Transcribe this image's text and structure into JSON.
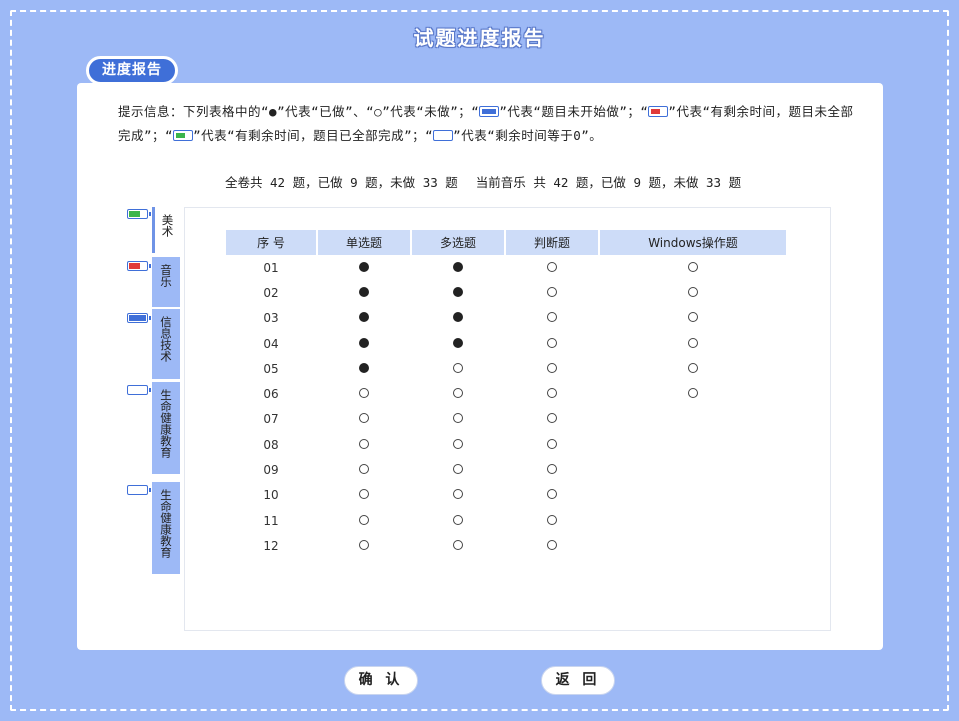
{
  "title": "试题进度报告",
  "tab": {
    "label": "进度报告"
  },
  "hint": {
    "prefix": "提示信息：下列表格中的“",
    "done_symbol": "●",
    "done_text": "”代表“已做”、“",
    "undone_symbol": "○",
    "undone_text": "”代表“未做”；“",
    "blue_text": "”代表“题目未开始做”；“",
    "red_text": "”代表“有剩余时间，题目未全部完成”；“",
    "green_text": "”代表“有剩余时间，题目已全部完成”；“",
    "empty_text": "”代表“剩余时间等于0”。"
  },
  "stats": {
    "overall": "全卷共 42 题，已做 9 题，未做 33 题",
    "current": "当前音乐 共 42 题，已做 9 题，未做 33 题"
  },
  "subjects": [
    {
      "label": "美术",
      "status": "green",
      "active": true
    },
    {
      "label": "音乐",
      "status": "red",
      "active": false
    },
    {
      "label": "信息技术",
      "status": "blue",
      "active": false
    },
    {
      "label": "生命健康教育",
      "status": "empty",
      "active": false
    },
    {
      "label": "生命健康教育",
      "status": "empty",
      "active": false
    }
  ],
  "colors": {
    "blue": "#3f6fd8",
    "red": "#e03a3a",
    "green": "#3bb54a",
    "background": "#9db9f6"
  },
  "table": {
    "headers": [
      "序 号",
      "单选题",
      "多选题",
      "判断题",
      "Windows操作题"
    ],
    "rows": [
      {
        "no": "01",
        "cells": [
          "done",
          "done",
          "undone",
          "undone"
        ]
      },
      {
        "no": "02",
        "cells": [
          "done",
          "done",
          "undone",
          "undone"
        ]
      },
      {
        "no": "03",
        "cells": [
          "done",
          "done",
          "undone",
          "undone"
        ]
      },
      {
        "no": "04",
        "cells": [
          "done",
          "done",
          "undone",
          "undone"
        ]
      },
      {
        "no": "05",
        "cells": [
          "done",
          "undone",
          "undone",
          "undone"
        ]
      },
      {
        "no": "06",
        "cells": [
          "undone",
          "undone",
          "undone",
          "undone"
        ]
      },
      {
        "no": "07",
        "cells": [
          "undone",
          "undone",
          "undone",
          ""
        ]
      },
      {
        "no": "08",
        "cells": [
          "undone",
          "undone",
          "undone",
          ""
        ]
      },
      {
        "no": "09",
        "cells": [
          "undone",
          "undone",
          "undone",
          ""
        ]
      },
      {
        "no": "10",
        "cells": [
          "undone",
          "undone",
          "undone",
          ""
        ]
      },
      {
        "no": "11",
        "cells": [
          "undone",
          "undone",
          "undone",
          ""
        ]
      },
      {
        "no": "12",
        "cells": [
          "undone",
          "undone",
          "undone",
          ""
        ]
      }
    ]
  },
  "buttons": {
    "confirm": "确 认",
    "back": "返 回"
  }
}
